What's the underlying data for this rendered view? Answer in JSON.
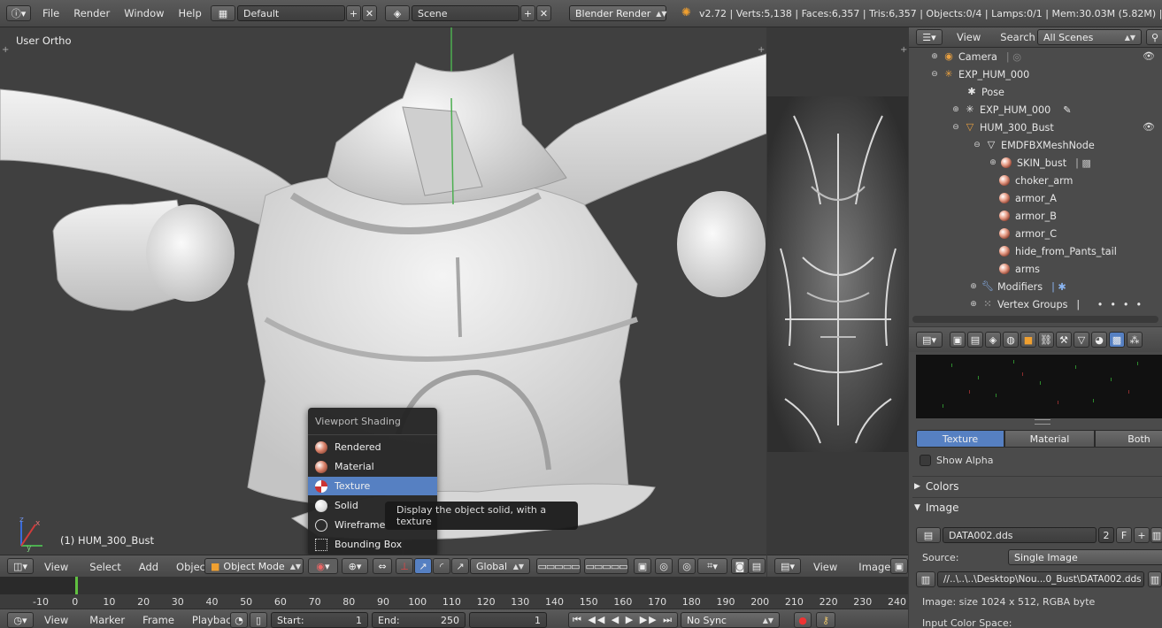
{
  "topbar": {
    "menus": [
      "File",
      "Render",
      "Window",
      "Help"
    ],
    "layout": "Default",
    "scene": "Scene",
    "engine": "Blender Render",
    "stats": "v2.72 | Verts:5,138 | Faces:6,357 | Tris:6,357 | Objects:0/4 | Lamps:0/1 | Mem:30.03M (5.82M) | HUM"
  },
  "viewport": {
    "view_label": "User Ortho",
    "object_label": "(1) HUM_300_Bust",
    "axis_z": "z",
    "axis_y": "y",
    "axis_x": "x"
  },
  "shading_popup": {
    "title": "Viewport Shading",
    "items": [
      {
        "label": "Rendered"
      },
      {
        "label": "Material"
      },
      {
        "label": "Texture"
      },
      {
        "label": "Solid"
      },
      {
        "label": "Wireframe"
      },
      {
        "label": "Bounding Box"
      }
    ],
    "selected": "Texture",
    "tooltip": "Display the object solid, with a texture"
  },
  "view_header": {
    "menus": [
      "View",
      "Select",
      "Add",
      "Object"
    ],
    "mode": "Object Mode",
    "orientation": "Global"
  },
  "image_header": {
    "menus": [
      "View",
      "Image"
    ]
  },
  "outliner": {
    "menus": [
      "View",
      "Search"
    ],
    "filter": "All Scenes",
    "rows": [
      {
        "label": "Camera"
      },
      {
        "label": "EXP_HUM_000"
      },
      {
        "label": "Pose"
      },
      {
        "label": "EXP_HUM_000"
      },
      {
        "label": "HUM_300_Bust"
      },
      {
        "label": "EMDFBXMeshNode"
      },
      {
        "label": "SKIN_bust"
      },
      {
        "label": "choker_arm"
      },
      {
        "label": "armor_A"
      },
      {
        "label": "armor_B"
      },
      {
        "label": "armor_C"
      },
      {
        "label": "hide_from_Pants_tail"
      },
      {
        "label": "arms"
      },
      {
        "label": "Modifiers"
      },
      {
        "label": "Vertex Groups"
      }
    ]
  },
  "properties": {
    "tabs": [
      "Texture",
      "Material",
      "Both"
    ],
    "active_tab": "Texture",
    "show_alpha": "Show Alpha",
    "panels": {
      "colors": "Colors",
      "image": "Image"
    },
    "image_name": "DATA002.dds",
    "users": "2",
    "fake": "F",
    "source_label": "Source:",
    "source_value": "Single Image",
    "filepath": "//..\\..\\..\\Desktop\\Nou...0_Bust\\DATA002.dds",
    "image_info": "Image: size 1024 x 512, RGBA byte",
    "color_space_label": "Input Color Space:"
  },
  "timeline": {
    "ticks": [
      "-10",
      "0",
      "10",
      "20",
      "30",
      "40",
      "50",
      "60",
      "70",
      "80",
      "90",
      "100",
      "110",
      "120",
      "130",
      "140",
      "150",
      "160",
      "170",
      "180",
      "190",
      "200",
      "210",
      "220",
      "230",
      "240"
    ],
    "menus": [
      "View",
      "Marker",
      "Frame",
      "Playback"
    ],
    "start_label": "Start:",
    "start_value": "1",
    "end_label": "End:",
    "end_value": "250",
    "current_frame": "1",
    "sync": "No Sync"
  }
}
